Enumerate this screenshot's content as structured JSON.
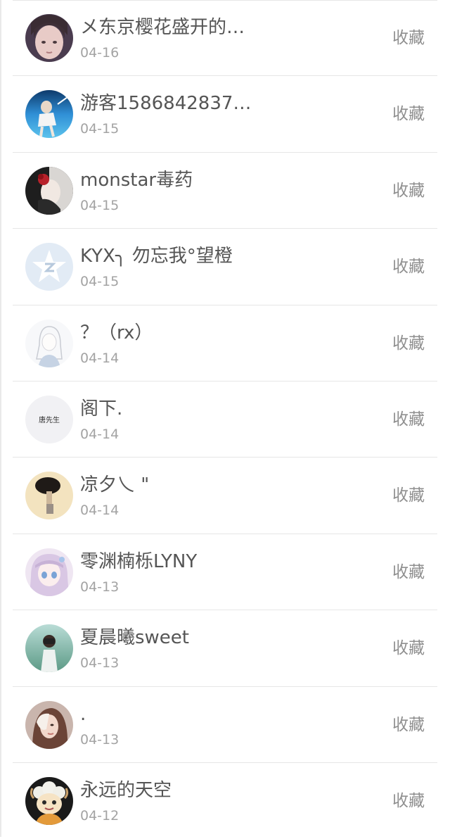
{
  "favorite_label": "收藏",
  "users": [
    {
      "name": "メ东京樱花盛开的…",
      "date": "04-16",
      "avatar_icon": "girl-portrait-avatar",
      "avatar_color": "#5b4a5e"
    },
    {
      "name": "游客1586842837…",
      "date": "04-15",
      "avatar_icon": "underwater-figure-avatar",
      "avatar_color": "#2e7fc4"
    },
    {
      "name": "monstar毒药",
      "date": "04-15",
      "avatar_icon": "rose-dark-avatar",
      "avatar_color": "#2b2b2b"
    },
    {
      "name": "KYX╮ 勿忘我°望橙",
      "date": "04-15",
      "avatar_icon": "default-star-avatar",
      "avatar_color": "#e3ecf6"
    },
    {
      "name": "？（rx）",
      "date": "04-14",
      "avatar_icon": "sketch-girl-avatar",
      "avatar_color": "#f4f5f8"
    },
    {
      "name": "阁下.",
      "date": "04-14",
      "avatar_icon": "text-logo-avatar",
      "avatar_color": "#f2f2f5"
    },
    {
      "name": "凉夕乀 \"",
      "date": "04-14",
      "avatar_icon": "afro-figure-avatar",
      "avatar_color": "#f3e2bd"
    },
    {
      "name": "零渊楠栎LYNY",
      "date": "04-13",
      "avatar_icon": "anime-girl-avatar",
      "avatar_color": "#e9dcef"
    },
    {
      "name": "夏晨曦sweet",
      "date": "04-13",
      "avatar_icon": "camera-girl-avatar",
      "avatar_color": "#8fc0b5"
    },
    {
      "name": ".",
      "date": "04-13",
      "avatar_icon": "woman-portrait-avatar",
      "avatar_color": "#b58d82"
    },
    {
      "name": "永远的天空",
      "date": "04-12",
      "avatar_icon": "cartoon-sheep-avatar",
      "avatar_color": "#1c1c1c"
    }
  ],
  "avatar_text": "唐先生"
}
